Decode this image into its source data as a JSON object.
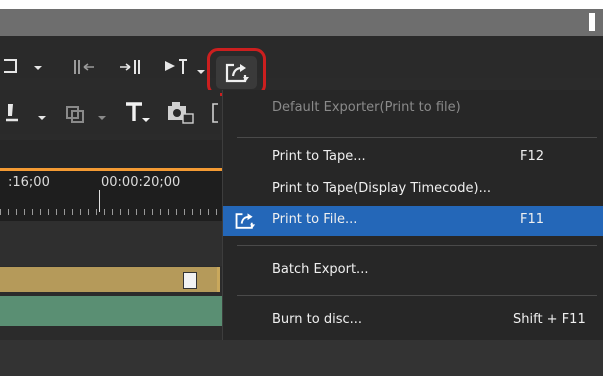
{
  "timeline": {
    "timecode_left": ":16;00",
    "timecode_right": "00:00:20;00"
  },
  "toolbar": {
    "icons": [
      "snapshot-dropdown-icon",
      "set-in-icon",
      "set-out-icon",
      "in-out-dropdown-icon",
      "export-icon",
      "add-marker-icon",
      "sync-icon",
      "title-icon",
      "effects-icon"
    ]
  },
  "menu": {
    "header": "Default Exporter(Print to file)",
    "items": [
      {
        "label": "Print to Tape...",
        "shortcut": "F12"
      },
      {
        "label": "Print to Tape(Display Timecode)...",
        "shortcut": ""
      },
      {
        "label": "Print to File...",
        "shortcut": "F11"
      },
      {
        "label": "Batch Export...",
        "shortcut": ""
      },
      {
        "label": "Burn to disc...",
        "shortcut": "Shift + F11"
      }
    ]
  },
  "colors": {
    "accent_highlight": "#2467b8",
    "callout_border": "#cc1f1f",
    "playhead_line": "#f39a33",
    "clip_gold": "#b59a5a",
    "clip_green": "#5a8f73"
  }
}
